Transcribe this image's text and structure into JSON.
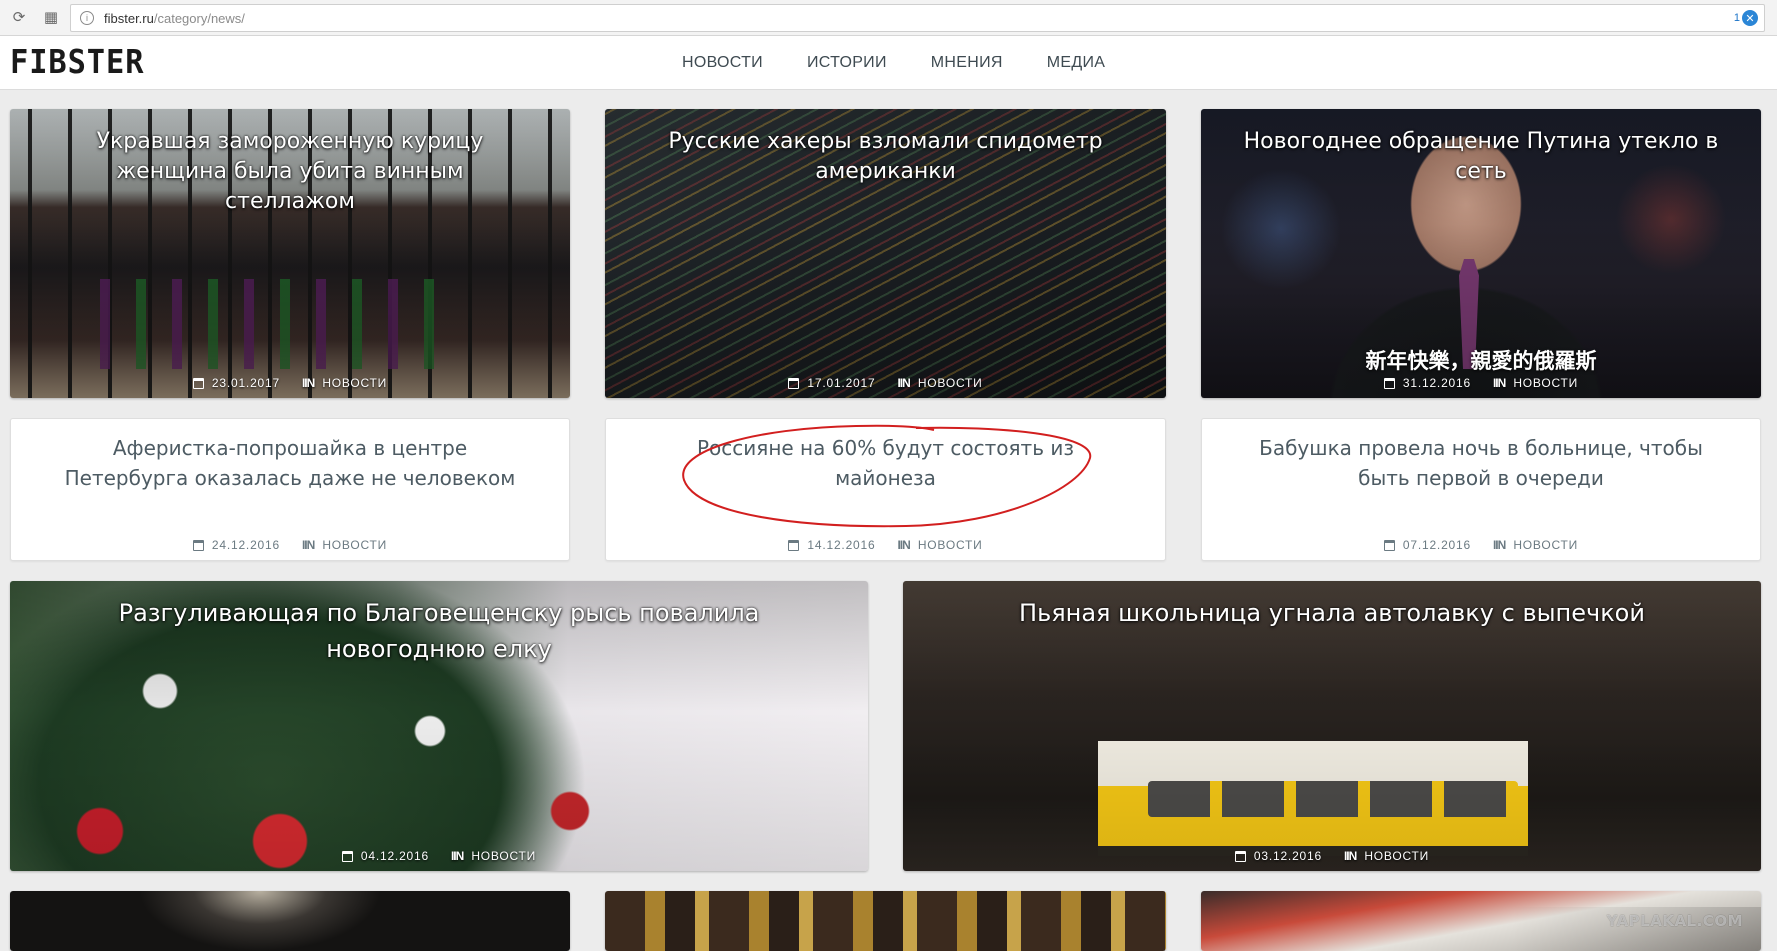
{
  "browser": {
    "url_host": "fibster.ru",
    "url_path": "/category/news/",
    "extension_count": "1",
    "reload_icon": "reload-icon",
    "apps_icon": "apps-grid-icon",
    "site_info_icon": "info-icon"
  },
  "site": {
    "logo": "FIBSTER",
    "nav": [
      "НОВОСТИ",
      "ИСТОРИИ",
      "МНЕНИЯ",
      "МЕДИА"
    ]
  },
  "colors": {
    "page_bg": "#ececec",
    "title_text": "#4d5b63",
    "meta_text": "#6b7a82",
    "annotation": "#d21f1f"
  },
  "articles": [
    {
      "title": "Укравшая замороженную курицу женщина была убита винным стеллажом",
      "date": "23.01.2017",
      "category": "НОВОСТИ",
      "style": "image"
    },
    {
      "title": "Русские хакеры взломали спидометр американки",
      "date": "17.01.2017",
      "category": "НОВОСТИ",
      "style": "image"
    },
    {
      "title": "Новогоднее обращение Путина утекло в сеть",
      "date": "31.12.2016",
      "category": "НОВОСТИ",
      "style": "image",
      "image_caption": "新年快樂，親愛的俄羅斯"
    },
    {
      "title": "Аферистка-попрошайка в центре Петербурга оказалась даже не человеком",
      "date": "24.12.2016",
      "category": "НОВОСТИ",
      "style": "text"
    },
    {
      "title": "Россияне на 60% будут состоять из майонеза",
      "date": "14.12.2016",
      "category": "НОВОСТИ",
      "style": "text",
      "highlighted": true
    },
    {
      "title": "Бабушка провела ночь в больнице, чтобы быть первой в очереди",
      "date": "07.12.2016",
      "category": "НОВОСТИ",
      "style": "text"
    },
    {
      "title": "Разгуливающая по Благовещенску рысь повалила новогоднюю елку",
      "date": "04.12.2016",
      "category": "НОВОСТИ",
      "style": "image"
    },
    {
      "title": "Пьяная школьница угнала автолавку с выпечкой",
      "date": "03.12.2016",
      "category": "НОВОСТИ",
      "style": "image"
    }
  ],
  "watermark": "YAPLAKAL.COM"
}
